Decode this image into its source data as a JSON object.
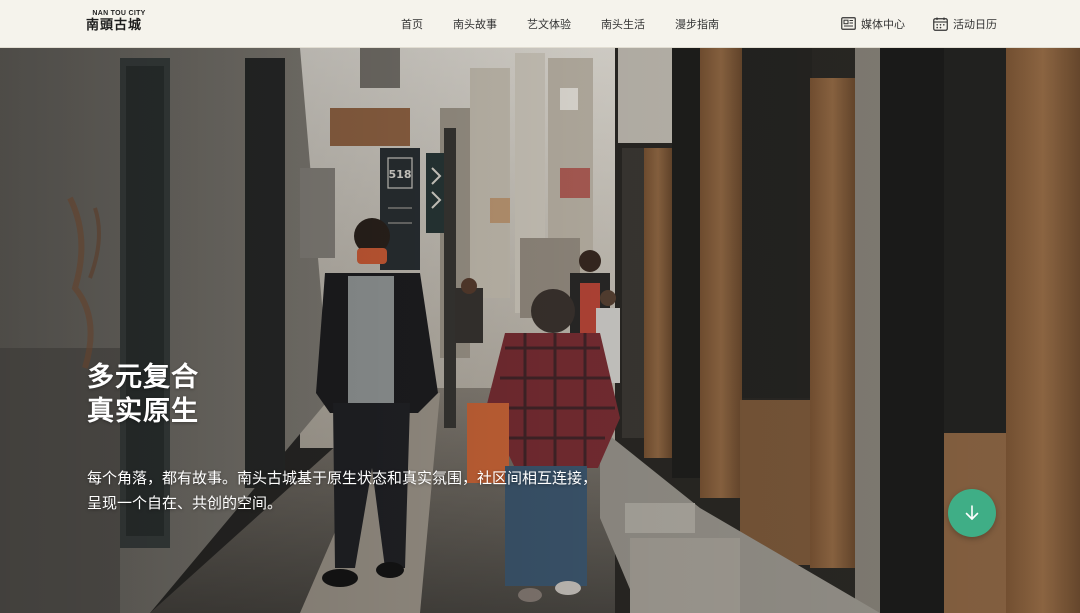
{
  "header": {
    "logo": {
      "subtitle": "NAN TOU CITY",
      "title": "南頭古城"
    },
    "nav": [
      {
        "label": "首页"
      },
      {
        "label": "南头故事"
      },
      {
        "label": "艺文体验"
      },
      {
        "label": "南头生活"
      },
      {
        "label": "漫步指南"
      }
    ],
    "utility": {
      "media_label": "媒体中心",
      "media_icon": "newspaper-icon",
      "calendar_label": "活动日历",
      "calendar_icon": "calendar-icon"
    }
  },
  "hero": {
    "headline_line1": "多元复合",
    "headline_line2": "真实原生",
    "description": "每个角落，都有故事。南头古城基于原生状态和真实氛围，社区间相互连接，呈现一个自在、共创的空间。",
    "shop_sign": "518",
    "scroll_button_icon": "arrow-down-icon"
  },
  "colors": {
    "header_bg": "#f5f3ec",
    "accent_green": "#3fae86",
    "text_dark": "#333333"
  }
}
